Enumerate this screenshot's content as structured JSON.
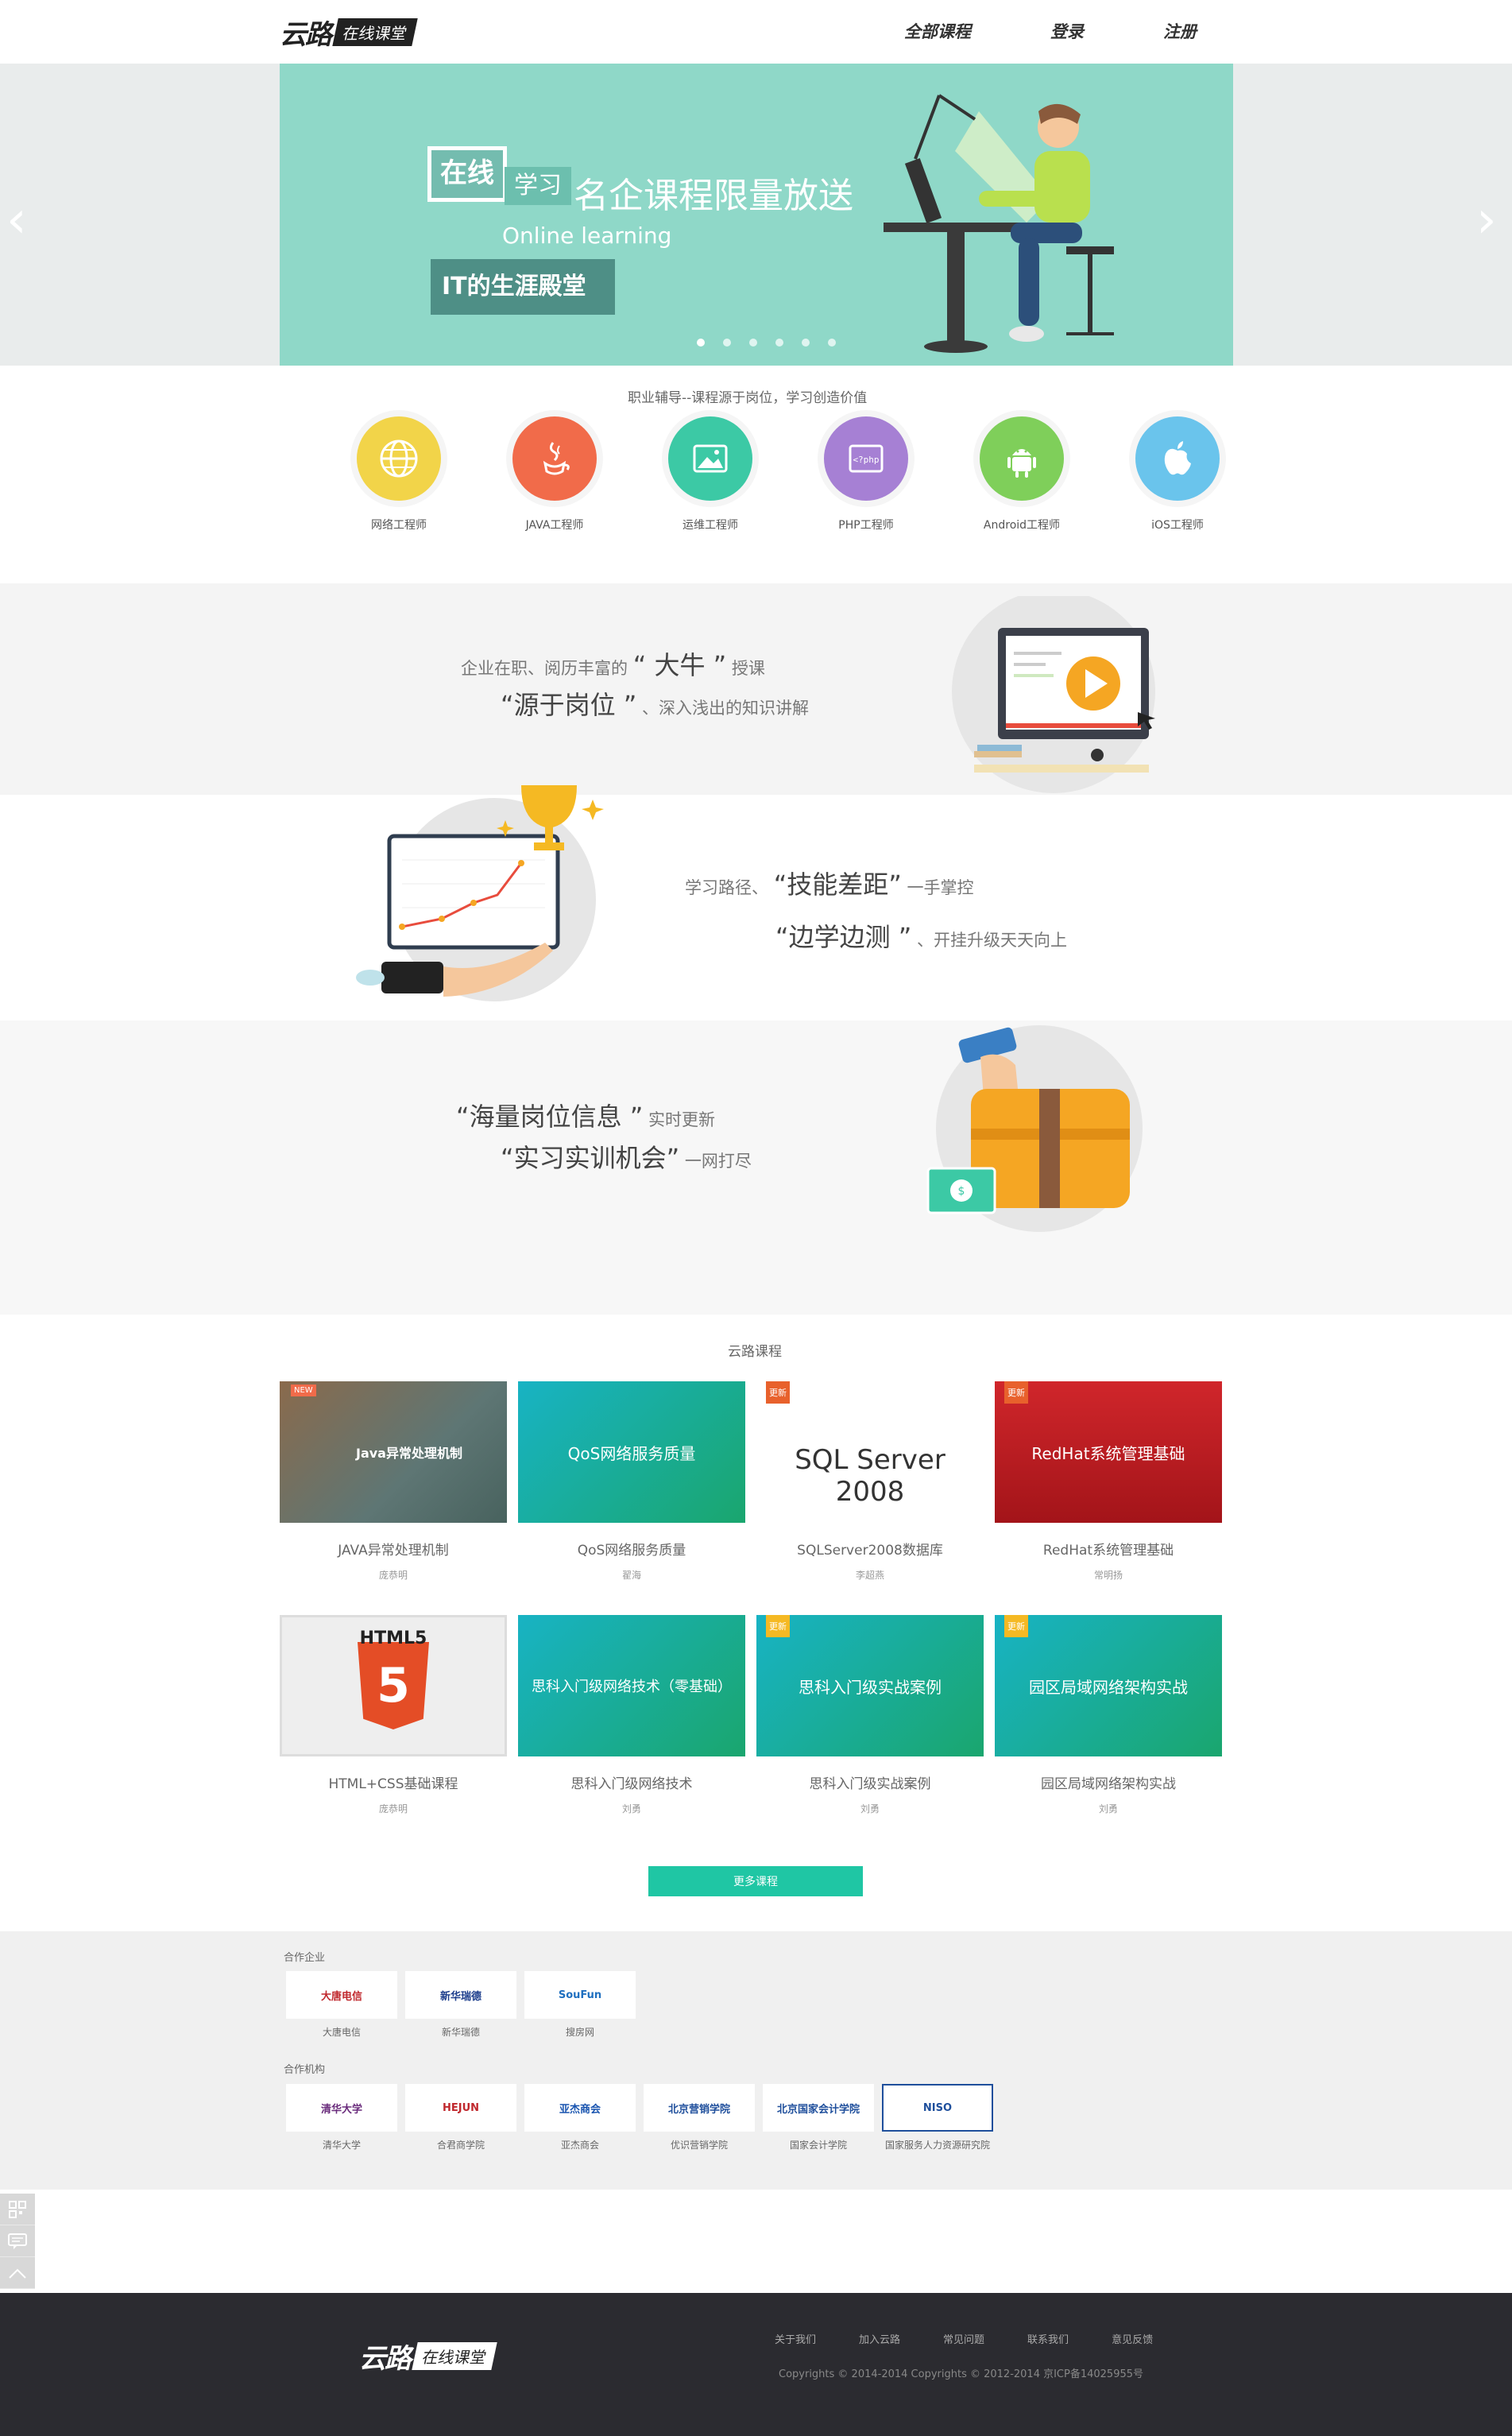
{
  "header": {
    "logo_mark": "云路",
    "logo_sub": "在线课堂",
    "nav": [
      "全部课程",
      "登录",
      "注册"
    ]
  },
  "banner": {
    "box_text": "在线",
    "tag_text": "学习",
    "title": "名企课程限量放送",
    "online": "Online learning",
    "badge": "IT的生涯殿堂",
    "dots": 6,
    "active_dot": 0,
    "background": "#8fd8c8"
  },
  "career_section": {
    "title": "职业辅导--课程源于岗位，学习创造价值",
    "items": [
      {
        "label": "网络工程师",
        "color": "#f2d449",
        "icon": "globe-icon"
      },
      {
        "label": "JAVA工程师",
        "color": "#f16b4a",
        "icon": "java-icon"
      },
      {
        "label": "运维工程师",
        "color": "#3cc9a5",
        "icon": "image-icon"
      },
      {
        "label": "PHP工程师",
        "color": "#a680d4",
        "icon": "php-icon"
      },
      {
        "label": "Android工程师",
        "color": "#7fcf5a",
        "icon": "android-icon"
      },
      {
        "label": "iOS工程师",
        "color": "#6ac4ec",
        "icon": "apple-icon"
      }
    ]
  },
  "features": {
    "f1": {
      "l1a": "企业在职、阅历丰富的",
      "l1b": "“ 大牛 ”",
      "l1c": "授课",
      "l2a": "“源于岗位 ”",
      "l2b": "、深入浅出的知识讲解"
    },
    "f2": {
      "l1a": "学习路径、",
      "l1b": "“技能差距”",
      "l1c": "一手掌控",
      "l2a": "“边学边测 ”",
      "l2b": "、开挂升级天天向上"
    },
    "f3": {
      "l1a": "“海量岗位信息 ”",
      "l1b": "实时更新",
      "l2a": "“实习实训机会”",
      "l2b": "一网打尽"
    }
  },
  "courses": {
    "title": "云路课程",
    "rows": [
      [
        {
          "thumb": "Java异常处理机制",
          "name": "JAVA异常处理机制",
          "teacher": "庞恭明",
          "badge": "NEW",
          "bg": "#6a7f7c"
        },
        {
          "thumb": "QoS网络服务质量",
          "name": "QoS网络服务质量",
          "teacher": "翟海",
          "badge": "",
          "bg": "#1aa3a0"
        },
        {
          "thumb": "SQL Server 2008",
          "name": "SQLServer2008数据库",
          "teacher": "李超燕",
          "badge": "更新",
          "bg": "#ffffff"
        },
        {
          "thumb": "RedHat系统管理基础",
          "name": "RedHat系统管理基础",
          "teacher": "常明扬",
          "badge": "更新",
          "bg": "#c01f24"
        }
      ],
      [
        {
          "thumb": "HTML5",
          "name": "HTML+CSS基础课程",
          "teacher": "庞恭明",
          "badge": "",
          "bg": "#eeeeee"
        },
        {
          "thumb": "思科入门级网络技术（零基础）",
          "name": "思科入门级网络技术",
          "teacher": "刘勇",
          "badge": "",
          "bg": "#1ba7a4"
        },
        {
          "thumb": "思科入门级实战案例",
          "name": "思科入门级实战案例",
          "teacher": "刘勇",
          "badge": "更新",
          "bg": "#1ba7a4"
        },
        {
          "thumb": "园区局域网络架构实战",
          "name": "园区局域网络架构实战",
          "teacher": "刘勇",
          "badge": "更新",
          "bg": "#1ba7a4"
        }
      ]
    ],
    "more_label": "更多课程"
  },
  "partners": {
    "enterprise_title": "合作企业",
    "enterprises": [
      {
        "logo": "大唐电信",
        "name": "大唐电信",
        "color": "#c0282d"
      },
      {
        "logo": "新华瑞德",
        "name": "新华瑞德",
        "color": "#1c3d8c"
      },
      {
        "logo": "SouFun",
        "name": "搜房网",
        "color": "#2070c0"
      }
    ],
    "institution_title": "合作机构",
    "institutions": [
      {
        "logo": "清华大学",
        "name": "清华大学",
        "color": "#6a2c7c"
      },
      {
        "logo": "HEJUN",
        "name": "合君商学院",
        "color": "#c0282d"
      },
      {
        "logo": "亚杰商会",
        "name": "亚杰商会",
        "color": "#1a55b0"
      },
      {
        "logo": "北京营销学院",
        "name": "优识营销学院",
        "color": "#1f4f9c"
      },
      {
        "logo": "北京国家会计学院",
        "name": "国家会计学院",
        "color": "#1f4f9c"
      },
      {
        "logo": "NISO",
        "name": "国家服务人力资源研究院",
        "color": "#1f4f9c"
      }
    ]
  },
  "footer": {
    "logo_mark": "云路",
    "logo_sub": "在线课堂",
    "links": [
      "关于我们",
      "加入云路",
      "常见问题",
      "联系我们",
      "意见反馈"
    ],
    "copyright": "Copyrights © 2014-2014   Copyrights © 2012-2014 京ICP备14025955号"
  }
}
